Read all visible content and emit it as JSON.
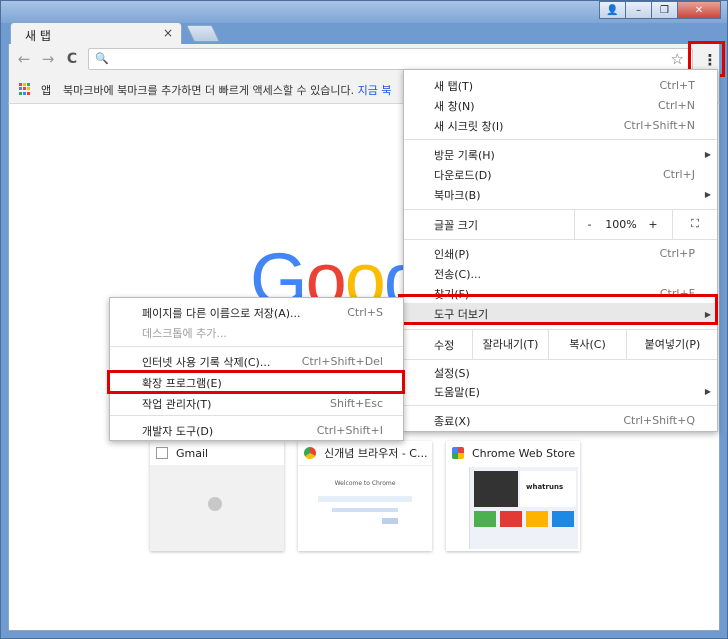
{
  "window": {
    "min": "–",
    "max": "❐",
    "close": "✕",
    "user": "👤"
  },
  "tab": {
    "title": "새 탭",
    "close": "×"
  },
  "toolbar": {
    "back": "←",
    "forward": "→",
    "reload": "C",
    "search_icon": "🔍",
    "star": "☆",
    "menu": "⋮"
  },
  "bookmarks": {
    "apps": "앱",
    "hint": "북마크바에 북마크를 추가하면 더 빠르게 액세스할 수 있습니다.",
    "link": "지금 북"
  },
  "google": {
    "letters": [
      "G",
      "o",
      "o",
      "g"
    ],
    "colors": [
      "#4285f4",
      "#ea4335",
      "#fbbc05",
      "#4285f4"
    ]
  },
  "tiles": [
    {
      "title": "Gmail"
    },
    {
      "title": "신개념 브라우저 - C..."
    },
    {
      "title": "Chrome Web Store"
    }
  ],
  "thumb_chrome": {
    "heading": "Welcome to Chrome"
  },
  "thumb_ws": {
    "brand": "whatruns"
  },
  "menu": {
    "new_tab": "새 탭(T)",
    "new_tab_sc": "Ctrl+T",
    "new_window": "새 창(N)",
    "new_window_sc": "Ctrl+N",
    "incognito": "새 시크릿 창(I)",
    "incognito_sc": "Ctrl+Shift+N",
    "history": "방문 기록(H)",
    "downloads": "다운로드(D)",
    "downloads_sc": "Ctrl+J",
    "bookmarks": "북마크(B)",
    "zoom_label": "글꼴 크기",
    "zoom_minus": "-",
    "zoom_value": "100%",
    "zoom_plus": "+",
    "fullscreen": "⛶",
    "print": "인쇄(P)",
    "print_sc": "Ctrl+P",
    "cast": "전송(C)...",
    "find": "찾기(F)",
    "find_sc": "Ctrl+F",
    "more_tools": "도구 더보기",
    "edit_label": "수정",
    "cut": "잘라내기(T)",
    "copy": "복사(C)",
    "paste": "붙여넣기(P)",
    "settings": "설정(S)",
    "help": "도움말(E)",
    "exit": "종료(X)",
    "exit_sc": "Ctrl+Shift+Q"
  },
  "submenu": {
    "save_as": "페이지를 다른 이름으로 저장(A)...",
    "save_as_sc": "Ctrl+S",
    "add_desktop": "데스크톱에 추가...",
    "clear_data": "인터넷 사용 기록 삭제(C)...",
    "clear_data_sc": "Ctrl+Shift+Del",
    "extensions": "확장 프로그램(E)",
    "task_manager": "작업 관리자(T)",
    "task_manager_sc": "Shift+Esc",
    "dev_tools": "개발자 도구(D)",
    "dev_tools_sc": "Ctrl+Shift+I"
  },
  "colors": {
    "highlight": "#e00000",
    "link": "#1a55d8"
  }
}
